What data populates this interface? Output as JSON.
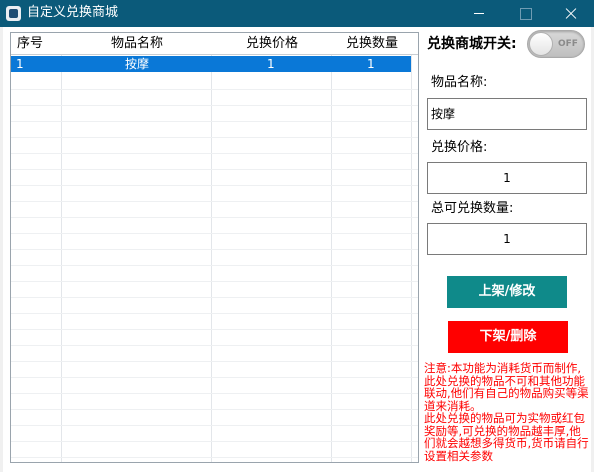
{
  "window": {
    "title": "自定义兑换商城"
  },
  "table": {
    "columns": [
      "序号",
      "物品名称",
      "兑换价格",
      "兑换数量"
    ],
    "rows": [
      {
        "index": "1",
        "name": "按摩",
        "price": "1",
        "quantity": "1",
        "selected": true
      }
    ]
  },
  "switch": {
    "label": "兑换商城开关:",
    "state": "OFF"
  },
  "form": {
    "name_label": "物品名称:",
    "name_value": "按摩",
    "price_label": "兑换价格:",
    "price_value": "1",
    "quantity_label": "总可兑换数量:",
    "quantity_value": "1"
  },
  "buttons": {
    "list_modify": "上架/修改",
    "unlist_delete": "下架/删除"
  },
  "note": {
    "line1": "注意:本功能为消耗货币而制作,此处兑换的物品不可和其他功能联动,他们有自己的物品购买等渠道来消耗。",
    "line2": "此处兑换的物品可为实物或红包奖励等,可兑换的物品越丰厚,他们就会越想多得货币,货币请自行设置相关参数"
  },
  "colors": {
    "titlebar": "#0b5a7a",
    "selection": "#0a78d7",
    "primary_button": "#0f8a8a",
    "danger_button": "#ff0000",
    "note_text": "#ff0000"
  }
}
